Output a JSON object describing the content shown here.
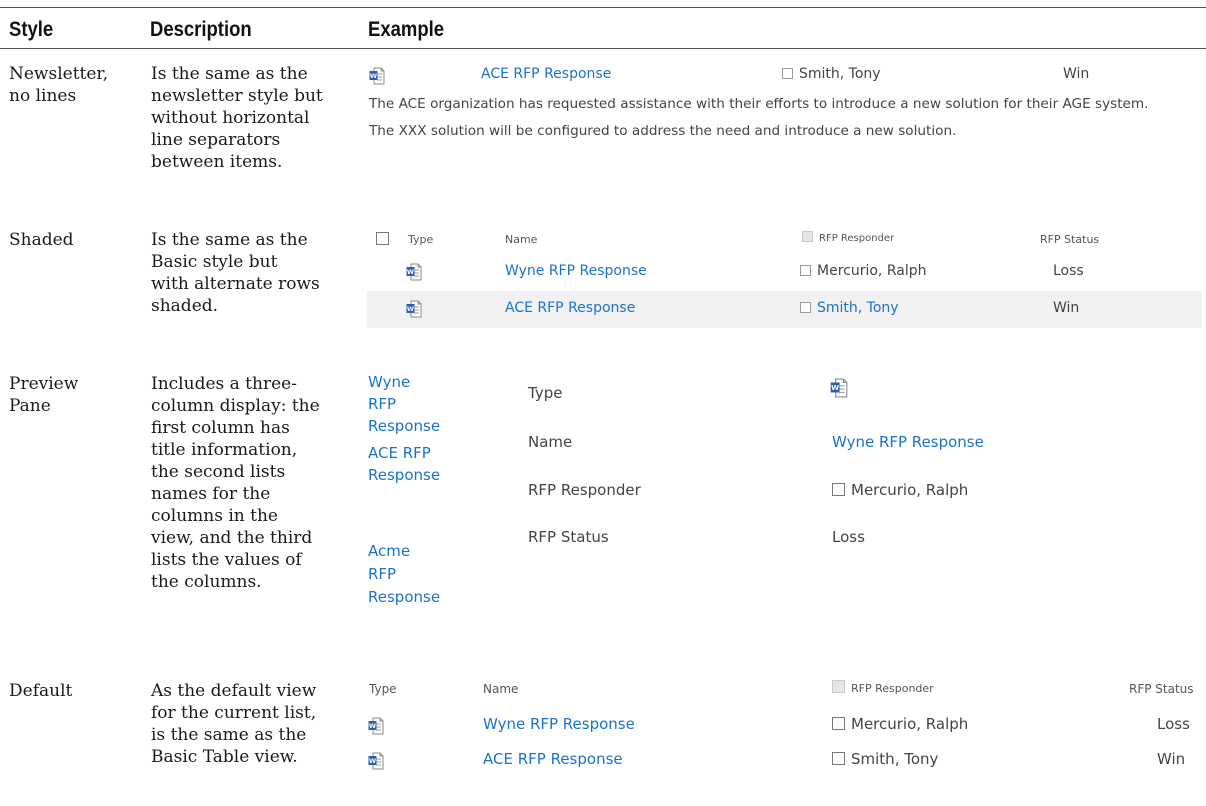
{
  "headers": {
    "style": "Style",
    "description": "Description",
    "example": "Example"
  },
  "rows": [
    {
      "style": [
        "Newsletter,",
        "no lines"
      ],
      "description": [
        "Is the same as the",
        "newsletter style but",
        "without horizontal",
        "line separators",
        "between items."
      ]
    },
    {
      "style": [
        "Shaded"
      ],
      "description": [
        "Is the same as the",
        "Basic style but",
        "with alternate rows",
        "shaded."
      ]
    },
    {
      "style": [
        "Preview",
        "Pane"
      ],
      "description": [
        "Includes a three-",
        "column display: the",
        "first column has",
        "title information,",
        "the second lists",
        "names for the",
        "columns in the",
        "view, and the third",
        "lists the values of",
        "the columns."
      ]
    },
    {
      "style": [
        "Default"
      ],
      "description": [
        "As the default view",
        "for the current list,",
        "is the same as the",
        "Basic Table view."
      ]
    }
  ],
  "newsletter": {
    "name": "ACE RFP Response",
    "responder": "Smith, Tony",
    "status": "Win",
    "body1": "The ACE organization has requested assistance with their efforts to introduce a new solution for their AGE system.",
    "body2": "The XXX solution will be configured to address the need and introduce a new solution."
  },
  "shaded": {
    "columns": {
      "type": "Type",
      "name": "Name",
      "responder": "RFP Responder",
      "status": "RFP Status"
    },
    "items": [
      {
        "name": "Wyne RFP Response",
        "responder": "Mercurio, Ralph",
        "status": "Loss"
      },
      {
        "name": "ACE RFP Response",
        "responder": "Smith, Tony",
        "status": "Win"
      }
    ]
  },
  "preview": {
    "titles": [
      [
        "Wyne",
        "RFP",
        "Response"
      ],
      [
        "ACE RFP",
        "Response"
      ],
      [
        "Acme",
        "RFP",
        "Response"
      ]
    ],
    "fields": [
      "Type",
      "Name",
      "RFP Responder",
      "RFP Status"
    ],
    "values": {
      "name": "Wyne RFP Response",
      "responder": "Mercurio, Ralph",
      "status": "Loss"
    }
  },
  "default": {
    "columns": {
      "type": "Type",
      "name": "Name",
      "responder": "RFP Responder",
      "status": "RFP Status"
    },
    "items": [
      {
        "name": "Wyne RFP Response",
        "responder": "Mercurio, Ralph",
        "status": "Loss"
      },
      {
        "name": "ACE RFP Response",
        "responder": "Smith, Tony",
        "status": "Win"
      }
    ]
  },
  "icons": {
    "doc": "word-document-icon"
  },
  "colors": {
    "link": "#1a73c9",
    "shade": "#f1f1f1"
  }
}
